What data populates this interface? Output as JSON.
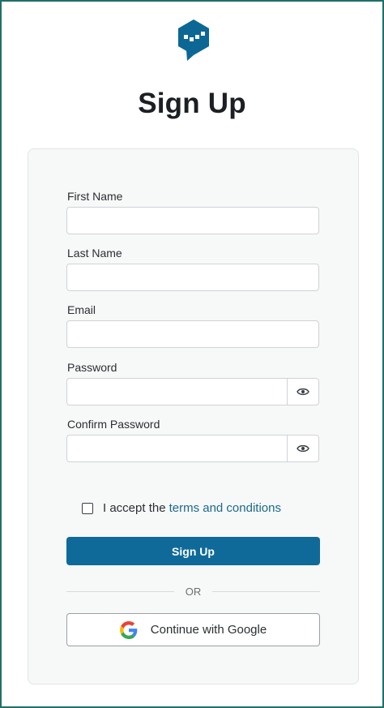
{
  "header": {
    "title": "Sign Up"
  },
  "form": {
    "first_name": {
      "label": "First Name",
      "value": "",
      "placeholder": ""
    },
    "last_name": {
      "label": "Last Name",
      "value": "",
      "placeholder": ""
    },
    "email": {
      "label": "Email",
      "value": "",
      "placeholder": ""
    },
    "password": {
      "label": "Password",
      "value": "",
      "placeholder": ""
    },
    "confirm_password": {
      "label": "Confirm Password",
      "value": "",
      "placeholder": ""
    },
    "terms": {
      "prefix": "I accept the",
      "link_text": "terms and conditions",
      "checked": false
    },
    "submit_label": "Sign Up",
    "divider_text": "OR",
    "google_label": "Continue with Google"
  },
  "icons": {
    "logo": "logo-icon",
    "password_toggle": "eye-icon",
    "google": "google-icon"
  },
  "colors": {
    "accent": "#0f6a99",
    "link": "#1a6a8c",
    "frame_border": "#1f6f68",
    "logo": "#0c6794"
  }
}
